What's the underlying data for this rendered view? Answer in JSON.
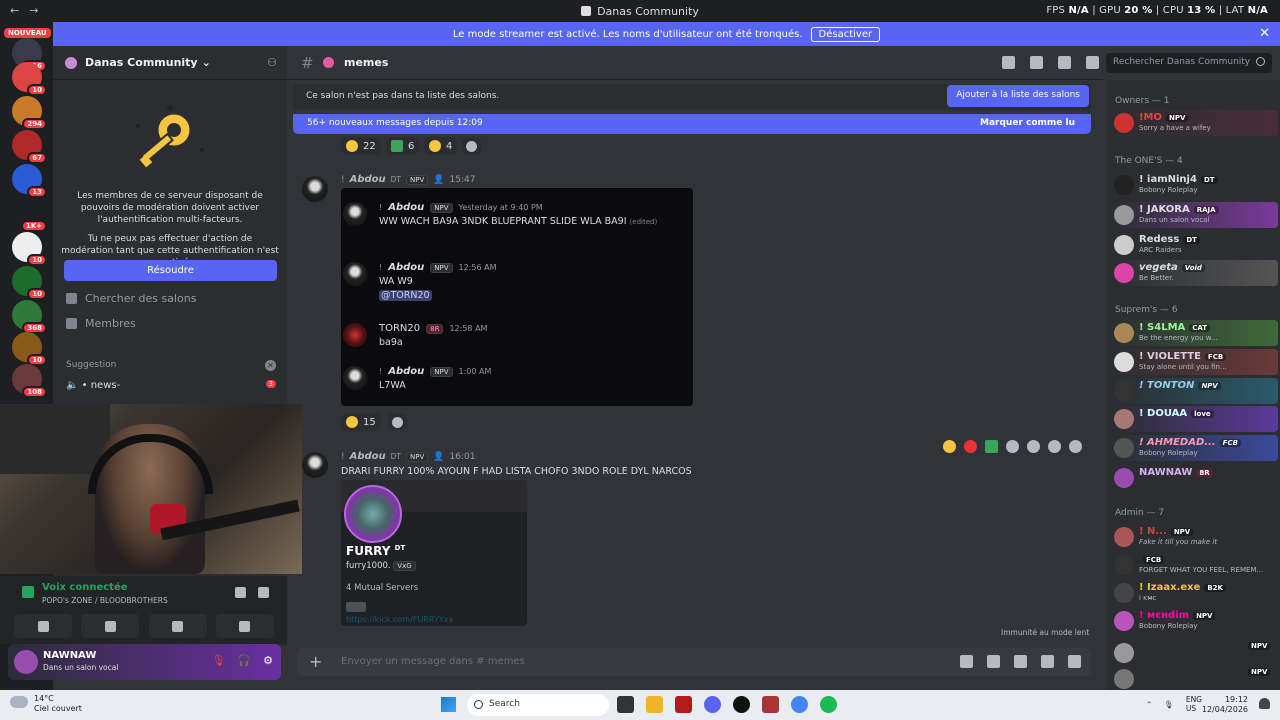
{
  "titlebar": {
    "title": "Danas Community",
    "fps_label": "FPS",
    "fps_value": "N/A",
    "gpu_label": "GPU",
    "gpu_value": "20 %",
    "cpu_label": "CPU",
    "cpu_value": "13 %",
    "lat_label": "LAT",
    "lat_value": "N/A"
  },
  "banner": {
    "text": "Le mode streamer est activé. Les noms d'utilisateur ont été tronqués.",
    "button": "Désactiver"
  },
  "servers": {
    "new_badge": "NOUVEAU",
    "badges": [
      "116",
      "10",
      "294",
      "67",
      "13",
      "1K+",
      "10",
      "10",
      "368",
      "10",
      "108"
    ]
  },
  "guild": {
    "name": "Danas Community"
  },
  "moderation": {
    "text1": "Les membres de ce serveur disposant de pouvoirs de modération doivent activer l'authentification multi-facteurs.",
    "text2": "Tu ne peux pas effectuer d'action de modération tant que cette authentification n'est pas activée.",
    "button": "Résoudre"
  },
  "channel_nav": {
    "browse": "Chercher des salons",
    "members": "Membres"
  },
  "suggestion": {
    "label": "Suggestion",
    "channel": "news-",
    "badge": "3"
  },
  "voice": {
    "status": "Voix connectée",
    "server": "POPO's ZONE / BLOODBROTHERS"
  },
  "user": {
    "name": "NAWNAW",
    "status": "Dans un salon vocal"
  },
  "channel": {
    "name": "memes"
  },
  "search": {
    "placeholder": "Rechercher Danas Community"
  },
  "notice": {
    "text": "Ce salon n'est pas dans ta liste des salons.",
    "button": "Ajouter à la liste des salons"
  },
  "newmsg": {
    "text": "56+ nouveaux messages depuis 12:09",
    "action": "Marquer comme lu"
  },
  "reactions1": [
    "22",
    "6",
    "4"
  ],
  "reactions2": [
    "15"
  ],
  "msg1": {
    "author": "Abdou",
    "tag": "DT",
    "badge": "NPV",
    "time": "15:47"
  },
  "embed": [
    {
      "prefix": "!",
      "author": "Abdou",
      "badge": "NPV",
      "time": "Yesterday at 9:40 PM",
      "text": "WW WACH BA9A 3NDK BLUEPRANT SLIDE WLA BA9I",
      "edited": "(edited)"
    },
    {
      "prefix": "!",
      "author": "Abdou",
      "badge": "NPV",
      "time": "12:56 AM",
      "text": "WA W9",
      "mention": "@TORN20"
    },
    {
      "author": "TORN20",
      "badge": "8R",
      "time": "12:58 AM",
      "text": "ba9a"
    },
    {
      "prefix": "!",
      "author": "Abdou",
      "badge": "NPV",
      "time": "1:00 AM",
      "text": "L7WA"
    }
  ],
  "msg2": {
    "author": "Abdou",
    "tag": "DT",
    "badge": "NPV",
    "time": "16:01",
    "text": "DRARI FURRY 100% AYOUN F HAD LISTA CHOFO 3NDO ROLE DYL NARCOS"
  },
  "profile": {
    "name": "FURRY",
    "sup": "DT",
    "username": "furry1000.",
    "tag": "VxG",
    "mutual": "4 Mutual Servers",
    "link": "https://kick.com/FURRYYxx"
  },
  "slowmode": "Immunité au mode lent",
  "composer": {
    "placeholder": "Envoyer un message dans #",
    "channel": "memes"
  },
  "member_groups": [
    {
      "label": "Owners — 1"
    },
    {
      "label": "The ONE'S — 4"
    },
    {
      "label": "Suprem's — 6"
    },
    {
      "label": "Admin — 7"
    }
  ],
  "member_list": [
    {
      "name": "!MO",
      "tag": "NPV",
      "status": "Sorry a have a wifey"
    },
    {
      "name": "! iamNinj4",
      "tag": "DT",
      "status": "Bobony Roleplay"
    },
    {
      "name": "! JAKORA",
      "tag": "RAJA",
      "status": "Dans un salon vocal"
    },
    {
      "name": "Redess",
      "tag": "DT",
      "status": "ARC Raiders"
    },
    {
      "name": "vegeta",
      "tag": "Void",
      "status": "Be Better."
    },
    {
      "name": "! S4LMA",
      "tag": "CAT",
      "status": "Be the energy you w..."
    },
    {
      "name": "! VIOLETTE",
      "tag": "FCB",
      "status": "Stay alone until you fin..."
    },
    {
      "name": "! TONTON",
      "tag": "NPV",
      "status": ""
    },
    {
      "name": "! DOUAA",
      "tag": "love",
      "status": ""
    },
    {
      "name": "! AHMEDAD...",
      "tag": "FCB",
      "status": "Bobony Roleplay"
    },
    {
      "name": "NAWNAW",
      "tag": "8R",
      "status": ""
    },
    {
      "name": "! N...",
      "tag": "NPV",
      "status": "Fake it till you make it"
    },
    {
      "name": "",
      "tag": "FCB",
      "status": "FORGET WHAT YOU FEEL, REMEM..."
    },
    {
      "name": "! Izaax.exe",
      "tag": "B2K",
      "status": ""
    },
    {
      "name": "! мєнdim",
      "tag": "NPV",
      "status": "Bobony Roleplay"
    },
    {
      "name": "",
      "tag": "NPV",
      "status": ""
    },
    {
      "name": "",
      "tag": "NPV",
      "status": ""
    }
  ],
  "taskbar": {
    "temp": "14°C",
    "weather": "Ciel couvert",
    "search": "Search",
    "lang1": "ENG",
    "lang2": "US",
    "time": "19:12",
    "date": "12/04/2026"
  }
}
